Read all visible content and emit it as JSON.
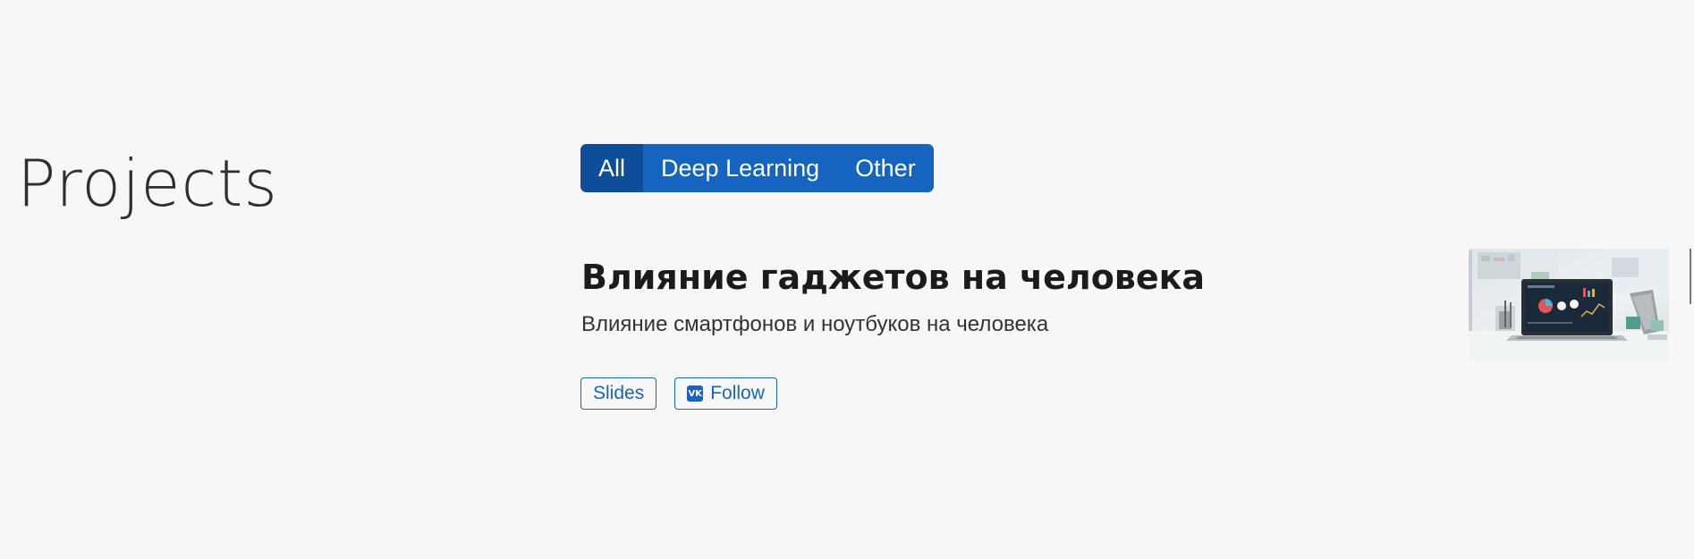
{
  "section": {
    "title": "Projects"
  },
  "filters": {
    "items": [
      "All",
      "Deep Learning",
      "Other"
    ],
    "active": "All"
  },
  "project": {
    "title": "Влияние гаджетов на человека",
    "summary": "Влияние смартфонов и ноутбуков на человека",
    "links": {
      "slides_label": "Slides",
      "follow_label": "Follow",
      "follow_icon": "vk-icon",
      "vk_glyph": "VK"
    },
    "image": {
      "icon": "laptop-dashboard-image"
    }
  },
  "colors": {
    "accent": "#1565c0",
    "accent_active": "#0d4d99",
    "background": "#f7f7f7"
  }
}
